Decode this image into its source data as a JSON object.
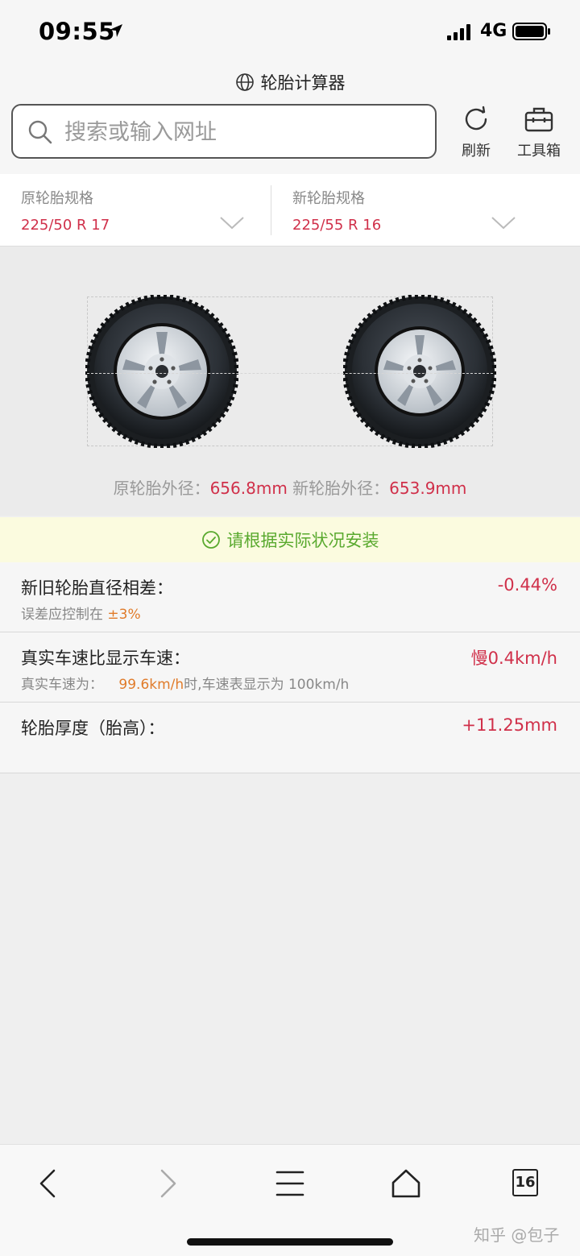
{
  "status_bar": {
    "time": "09:55",
    "network": "4G"
  },
  "browser": {
    "page_title": "轮胎计算器",
    "search": {
      "placeholder": "搜索或输入网址",
      "value": ""
    },
    "refresh_label": "刷新",
    "toolbox_label": "工具箱"
  },
  "spec": {
    "original": {
      "label": "原轮胎规格",
      "value": "225/50 R 17"
    },
    "new": {
      "label": "新轮胎规格",
      "value": "225/55 R 16"
    }
  },
  "diameter": {
    "orig_label": "原轮胎外径：",
    "orig_value": "656.8mm",
    "new_label": "新轮胎外径：",
    "new_value": "653.9mm"
  },
  "notice": {
    "text": "请根据实际状况安装"
  },
  "results": [
    {
      "title": "新旧轮胎直径相差：",
      "value": "-0.44%",
      "sub_prefix": "误差应控制在",
      "sub_highlight": "±3%",
      "sub_suffix": ""
    },
    {
      "title": "真实车速比显示车速：",
      "value": "慢0.4km/h",
      "sub_prefix": "真实车速为：",
      "sub_highlight": "99.6km/h",
      "sub_suffix": "时,车速表显示为 100km/h"
    },
    {
      "title": "轮胎厚度（胎高）：",
      "value": "+11.25mm"
    }
  ],
  "toolbar": {
    "tabs_count": "16"
  },
  "watermark": "知乎 @包子",
  "colors": {
    "accent_red": "#d0304a",
    "accent_orange": "#e07b2a",
    "notice_green": "#59a92e",
    "notice_bg": "#fbfbdf"
  }
}
